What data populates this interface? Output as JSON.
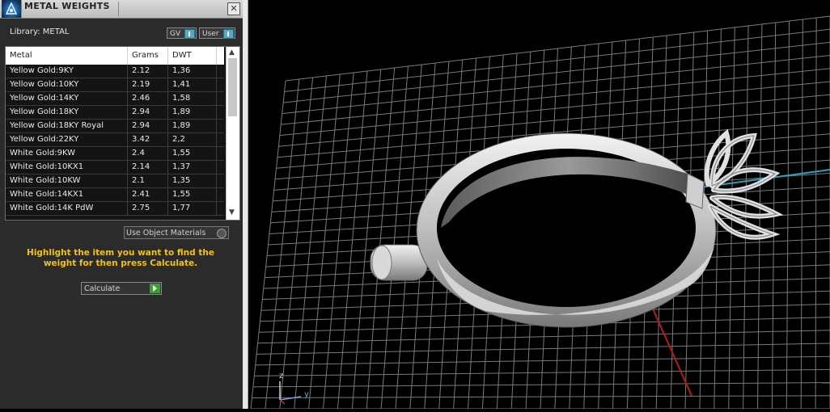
{
  "panel": {
    "title": "METAL WEIGHTS",
    "close_glyph": "✕",
    "library_label": "Library: METAL",
    "toggle_gv": "GV",
    "toggle_user": "User",
    "use_object_materials": "Use Object Materials",
    "hint": "Highlight the item you want to find the weight for then press Calculate.",
    "calculate": "Calculate"
  },
  "table": {
    "columns": [
      "Metal",
      "Grams",
      "DWT"
    ],
    "rows": [
      [
        "Yellow Gold:9KY",
        "2.12",
        "1,36"
      ],
      [
        "Yellow Gold:10KY",
        "2.19",
        "1,41"
      ],
      [
        "Yellow Gold:14KY",
        "2.46",
        "1,58"
      ],
      [
        "Yellow Gold:18KY",
        "2.94",
        "1,89"
      ],
      [
        "Yellow Gold:18KY Royal",
        "2.94",
        "1,89"
      ],
      [
        "Yellow Gold:22KY",
        "3.42",
        "2,2"
      ],
      [
        "White Gold:9KW",
        "2.4",
        "1,55"
      ],
      [
        "White Gold:10KX1",
        "2.14",
        "1,37"
      ],
      [
        "White Gold:10KW",
        "2.1",
        "1,35"
      ],
      [
        "White Gold:14KX1",
        "2.41",
        "1,55"
      ],
      [
        "White Gold:14K PdW",
        "2.75",
        "1,77"
      ]
    ]
  },
  "viewport": {
    "axis_z": "z",
    "axis_y": "y"
  },
  "icons": {
    "app_logo": "app-logo-icon",
    "close": "close-icon",
    "scroll_up": "chevron-up-icon",
    "scroll_down": "chevron-down-icon",
    "calculate_go": "play-icon"
  },
  "colors": {
    "hint_text": "#f2c21b",
    "calc_go": "#3aa035",
    "toggle_knob": "#5aa7c0",
    "axis_x": "#c02020",
    "axis_y": "#2aa3c0"
  }
}
